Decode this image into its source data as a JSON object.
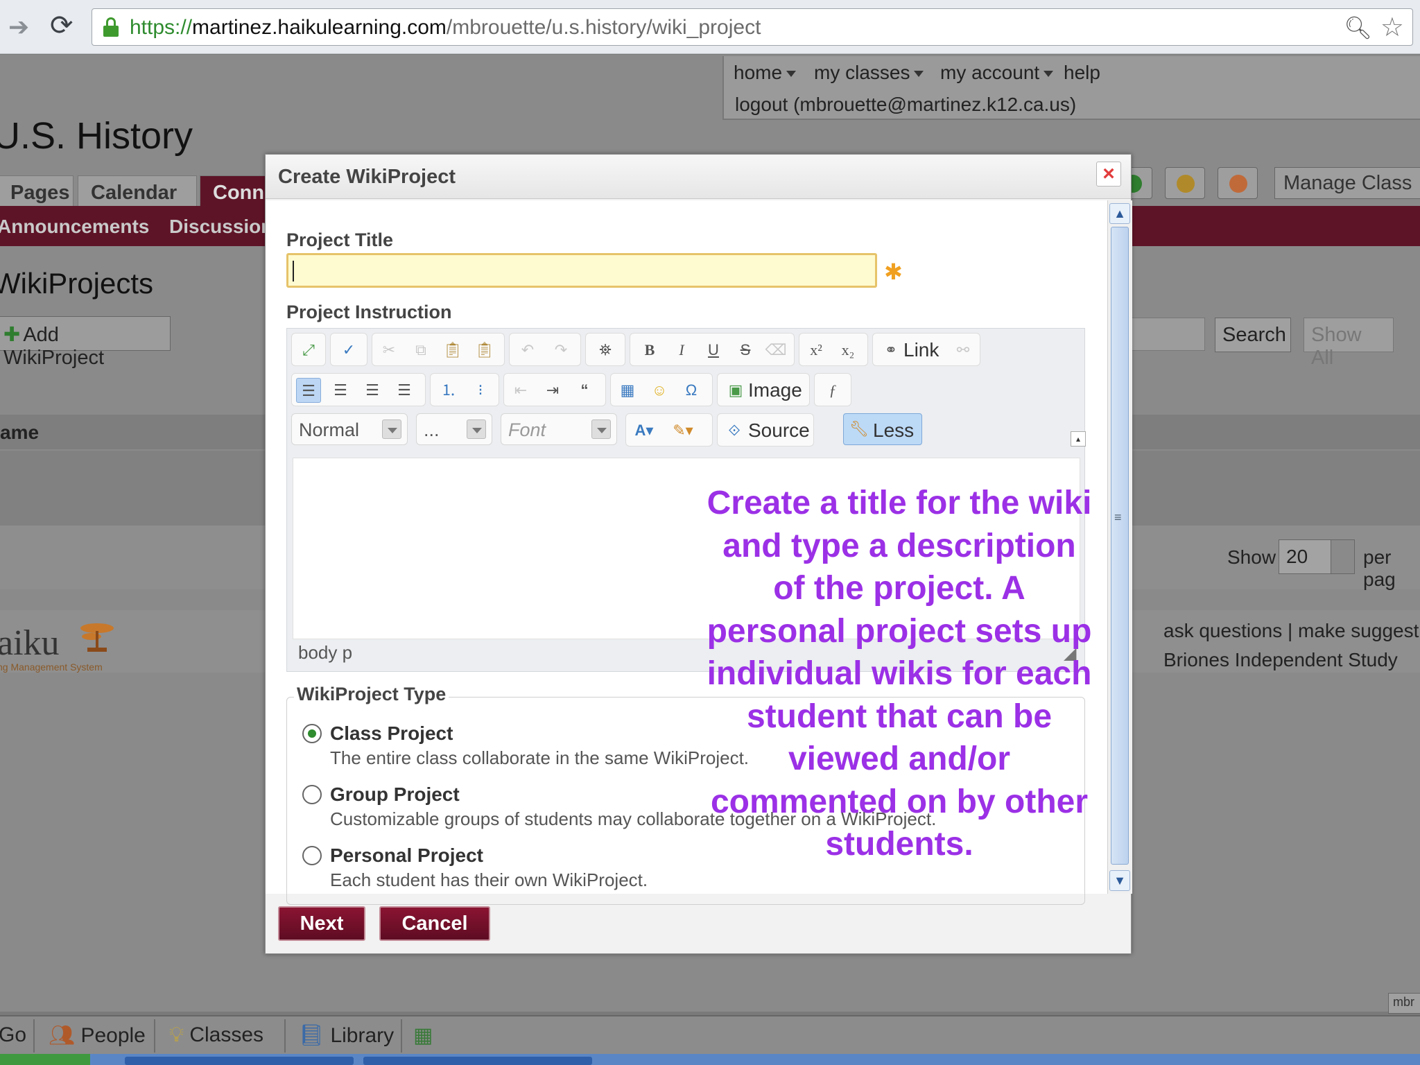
{
  "browser": {
    "url_scheme": "https://",
    "url_host": "martinez.haikulearning.com",
    "url_path": "/mbrouette/u.s.history/wiki_project"
  },
  "topnav": {
    "items": [
      "home",
      "my classes",
      "my account",
      "help"
    ],
    "logout": "logout (mbrouette@martinez.k12.ca.us)"
  },
  "course": {
    "title": "U.S. History",
    "tabs": [
      "Pages",
      "Calendar",
      "Conn"
    ],
    "subnav": [
      "Announcements",
      "Discussion"
    ],
    "manage_class": "Manage Class"
  },
  "wiki_page": {
    "title": "WikiProjects",
    "add_button": "Add WikiProject",
    "search_button": "Search",
    "show_all_button": "Show All",
    "column_header": "ame",
    "show_label": "Show",
    "per_page_value": "20",
    "per_page_label": "per pag"
  },
  "footer": {
    "logo": "aiku",
    "logo_sub": "ng Management System",
    "links": "ask questions | make suggest",
    "school": "Briones Independent Study"
  },
  "bottom_bar": {
    "items": [
      "Go",
      "People",
      "Classes",
      "Library"
    ],
    "status_tab": "mbr"
  },
  "modal": {
    "title": "Create WikiProject",
    "close": "×",
    "project_title_label": "Project Title",
    "project_title_value": "",
    "required_mark": "✱",
    "project_instruction_label": "Project Instruction",
    "toolbar": {
      "link_label": "Link",
      "image_label": "Image",
      "source_label": "Source",
      "less_label": "Less",
      "format_value": "Normal",
      "size_value": "...",
      "font_value": "Font"
    },
    "editor_path": "body  p",
    "type_legend": "WikiProject Type",
    "types": [
      {
        "title": "Class Project",
        "desc": "The entire class collaborate in the same WikiProject.",
        "checked": true
      },
      {
        "title": "Group Project",
        "desc": "Customizable groups of students may collaborate together on a WikiProject.",
        "checked": false
      },
      {
        "title": "Personal Project",
        "desc": "Each student has their own WikiProject.",
        "checked": false
      }
    ],
    "next_button": "Next",
    "cancel_button": "Cancel"
  },
  "annotation": {
    "text": "Create a title for the wiki and type a description of the project.  A personal project sets up individual wikis for each student that can be viewed and/or commented on by other students."
  },
  "colors": {
    "brand": "#5e1427",
    "annotation": "#9b30e6",
    "required": "#f0a020"
  }
}
